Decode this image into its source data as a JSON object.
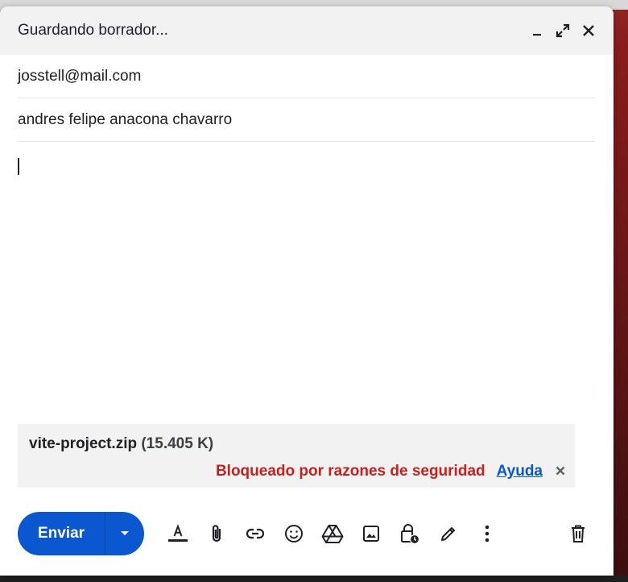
{
  "compose": {
    "title": "Guardando borrador...",
    "window_controls": [
      {
        "name": "minimize-icon"
      },
      {
        "name": "expand-icon"
      },
      {
        "name": "close-icon"
      }
    ],
    "to": "josstell@mail.com",
    "subject": "andres felipe anacona chavarro",
    "body": ""
  },
  "attachment": {
    "file_name": "vite-project.zip",
    "file_size": "(15.405 K)",
    "blocked_message": "Bloqueado por razones de seguridad",
    "help_link": "Ayuda",
    "remove_icon": "close-icon"
  },
  "toolbar": {
    "send_label": "Enviar",
    "more_send_icon": "arrow-down-icon",
    "tools": [
      "format-text-icon",
      "attach-file-icon",
      "insert-link-icon",
      "emoji-icon",
      "google-drive-icon",
      "insert-photo-icon",
      "confidential-mode-icon",
      "signature-icon",
      "more-options-icon"
    ],
    "discard_icon": "trash-icon"
  },
  "colors": {
    "send_button": "#0b57d0",
    "blocked_text": "#c5221f",
    "link": "#0b57d0",
    "header_bg": "#f2f2f2",
    "attachment_bg": "#f2f2f2"
  }
}
